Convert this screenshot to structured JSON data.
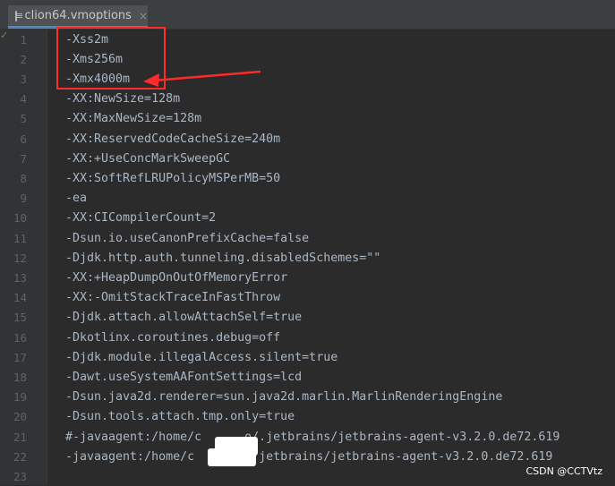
{
  "editor": {
    "tab": {
      "filename": "clion64.vmoptions",
      "close": "×",
      "icon": "file-icon"
    },
    "lines": [
      {
        "n": "1",
        "text": "-Xss2m"
      },
      {
        "n": "2",
        "text": "-Xms256m"
      },
      {
        "n": "3",
        "text": "-Xmx4000m"
      },
      {
        "n": "4",
        "text": "-XX:NewSize=128m"
      },
      {
        "n": "5",
        "text": "-XX:MaxNewSize=128m"
      },
      {
        "n": "6",
        "text": "-XX:ReservedCodeCacheSize=240m"
      },
      {
        "n": "7",
        "text": "-XX:+UseConcMarkSweepGC"
      },
      {
        "n": "8",
        "text": "-XX:SoftRefLRUPolicyMSPerMB=50"
      },
      {
        "n": "9",
        "text": "-ea"
      },
      {
        "n": "10",
        "text": "-XX:CICompilerCount=2"
      },
      {
        "n": "11",
        "text": "-Dsun.io.useCanonPrefixCache=false"
      },
      {
        "n": "12",
        "text": "-Djdk.http.auth.tunneling.disabledSchemes=\"\""
      },
      {
        "n": "13",
        "text": "-XX:+HeapDumpOnOutOfMemoryError"
      },
      {
        "n": "14",
        "text": "-XX:-OmitStackTraceInFastThrow"
      },
      {
        "n": "15",
        "text": "-Djdk.attach.allowAttachSelf=true"
      },
      {
        "n": "16",
        "text": "-Dkotlinx.coroutines.debug=off"
      },
      {
        "n": "17",
        "text": "-Djdk.module.illegalAccess.silent=true"
      },
      {
        "n": "18",
        "text": "-Dawt.useSystemAAFontSettings=lcd"
      },
      {
        "n": "19",
        "text": "-Dsun.java2d.renderer=sun.java2d.marlin.MarlinRenderingEngine"
      },
      {
        "n": "20",
        "text": "-Dsun.tools.attach.tmp.only=true"
      },
      {
        "n": "21",
        "text": "#-javaagent:/home/c      o/.jetbrains/jetbrains-agent-v3.2.0.de72.619"
      },
      {
        "n": "22",
        "text": "-javaagent:/home/c       /.jetbrains/jetbrains-agent-v3.2.0.de72.619"
      },
      {
        "n": "23",
        "text": ""
      }
    ]
  },
  "annotation": {
    "color": "#ff2a2a"
  },
  "watermark": "CSDN @CCTVtz"
}
